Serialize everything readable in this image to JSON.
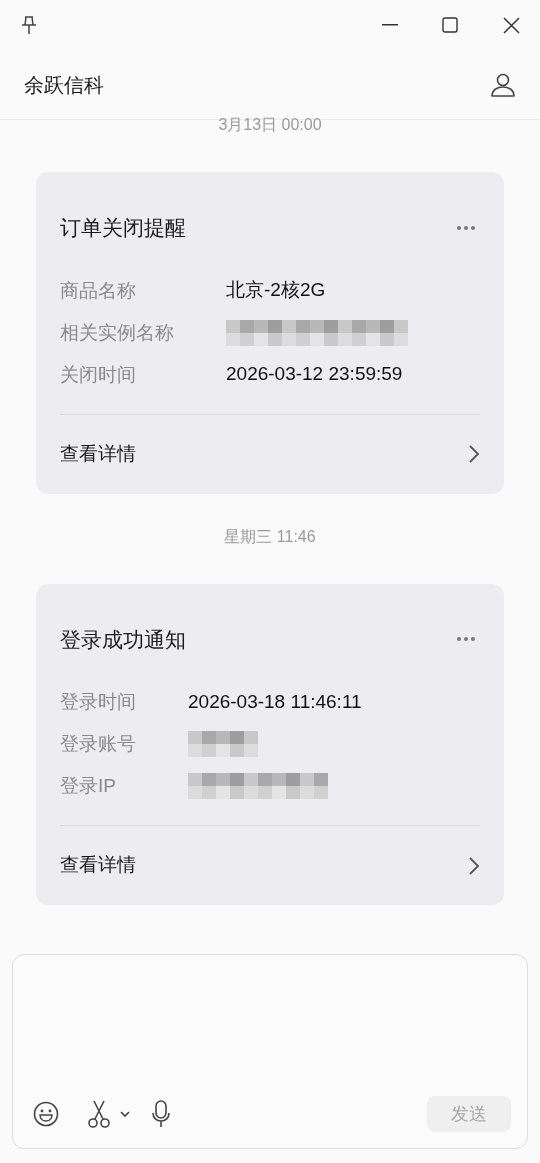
{
  "window": {
    "title": "余跃信科"
  },
  "messages": [
    {
      "time": "3月13日 00:00",
      "card": {
        "title": "订单关闭提醒",
        "fields": [
          {
            "label": "商品名称",
            "kind": "text",
            "value": "北京-2核2G"
          },
          {
            "label": "相关实例名称",
            "kind": "redacted"
          },
          {
            "label": "关闭时间",
            "kind": "text",
            "value": "2026-03-12 23:59:59"
          }
        ],
        "link": "查看详情"
      }
    },
    {
      "time": "星期三 11:46",
      "card": {
        "title": "登录成功通知",
        "fields": [
          {
            "label": "登录时间",
            "kind": "text",
            "value": "2026-03-18 11:46:11"
          },
          {
            "label": "登录账号",
            "kind": "redacted"
          },
          {
            "label": "登录IP",
            "kind": "redacted"
          }
        ],
        "link": "查看详情"
      }
    }
  ],
  "composer": {
    "send": "发送",
    "send_disabled": true
  }
}
